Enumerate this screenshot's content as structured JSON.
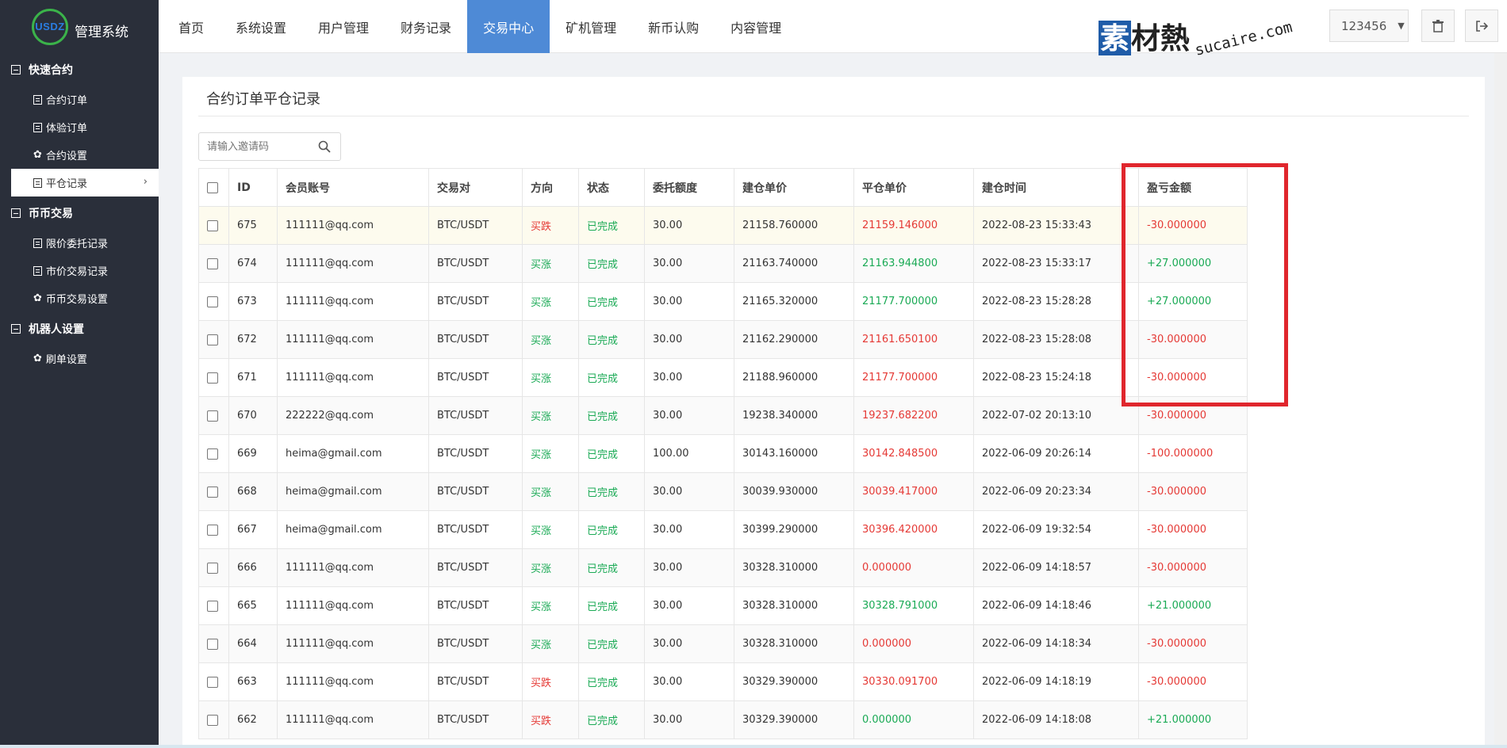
{
  "brand": {
    "logo_text": "USDZ",
    "title": "管理系统"
  },
  "sidebar": {
    "groups": [
      {
        "title": "快速合约",
        "items": [
          {
            "label": "合约订单",
            "icon": "doc-icon"
          },
          {
            "label": "体验订单",
            "icon": "doc-icon"
          },
          {
            "label": "合约设置",
            "icon": "gear-icon"
          },
          {
            "label": "平仓记录",
            "icon": "doc-icon",
            "active": true
          }
        ]
      },
      {
        "title": "币币交易",
        "items": [
          {
            "label": "限价委托记录",
            "icon": "doc-icon"
          },
          {
            "label": "市价交易记录",
            "icon": "doc-icon"
          },
          {
            "label": "币币交易设置",
            "icon": "gear-icon"
          }
        ]
      },
      {
        "title": "机器人设置",
        "items": [
          {
            "label": "刷单设置",
            "icon": "gear-icon"
          }
        ]
      }
    ]
  },
  "topnav": {
    "tabs": [
      "首页",
      "系统设置",
      "用户管理",
      "财务记录",
      "交易中心",
      "矿机管理",
      "新币认购",
      "内容管理"
    ],
    "active": "交易中心"
  },
  "watermark": {
    "main_a": "素",
    "main_b": "材熱",
    "sub": "sucaire.com"
  },
  "user": {
    "name": "123456"
  },
  "panel": {
    "title": "合约订单平仓记录"
  },
  "search": {
    "placeholder": "请输入邀请码"
  },
  "colors": {
    "accent": "#4e8ad6",
    "sidebar": "#2a2f3a",
    "up": "#1aaa55",
    "down": "#e53935",
    "highlight_box": "#e0262d"
  },
  "table": {
    "headers": [
      "ID",
      "会员账号",
      "交易对",
      "方向",
      "状态",
      "委托额度",
      "建仓单价",
      "平仓单价",
      "建仓时间",
      "盈亏金额"
    ],
    "rows": [
      {
        "id": "675",
        "account": "111111@qq.com",
        "pair": "BTC/USDT",
        "dir": "买跌",
        "status": "已完成",
        "amount": "30.00",
        "open": "21158.760000",
        "close": "21159.146000",
        "close_color": "red",
        "time": "2022-08-23 15:33:43",
        "pnl": "-30.000000",
        "pnl_color": "red",
        "dir_color": "red"
      },
      {
        "id": "674",
        "account": "111111@qq.com",
        "pair": "BTC/USDT",
        "dir": "买涨",
        "status": "已完成",
        "amount": "30.00",
        "open": "21163.740000",
        "close": "21163.944800",
        "close_color": "green",
        "time": "2022-08-23 15:33:17",
        "pnl": "+27.000000",
        "pnl_color": "green",
        "dir_color": "green"
      },
      {
        "id": "673",
        "account": "111111@qq.com",
        "pair": "BTC/USDT",
        "dir": "买涨",
        "status": "已完成",
        "amount": "30.00",
        "open": "21165.320000",
        "close": "21177.700000",
        "close_color": "green",
        "time": "2022-08-23 15:28:28",
        "pnl": "+27.000000",
        "pnl_color": "green",
        "dir_color": "green"
      },
      {
        "id": "672",
        "account": "111111@qq.com",
        "pair": "BTC/USDT",
        "dir": "买涨",
        "status": "已完成",
        "amount": "30.00",
        "open": "21162.290000",
        "close": "21161.650100",
        "close_color": "red",
        "time": "2022-08-23 15:28:08",
        "pnl": "-30.000000",
        "pnl_color": "red",
        "dir_color": "green"
      },
      {
        "id": "671",
        "account": "111111@qq.com",
        "pair": "BTC/USDT",
        "dir": "买涨",
        "status": "已完成",
        "amount": "30.00",
        "open": "21188.960000",
        "close": "21177.700000",
        "close_color": "red",
        "time": "2022-08-23 15:24:18",
        "pnl": "-30.000000",
        "pnl_color": "red",
        "dir_color": "green"
      },
      {
        "id": "670",
        "account": "222222@qq.com",
        "pair": "BTC/USDT",
        "dir": "买涨",
        "status": "已完成",
        "amount": "30.00",
        "open": "19238.340000",
        "close": "19237.682200",
        "close_color": "red",
        "time": "2022-07-02 20:13:10",
        "pnl": "-30.000000",
        "pnl_color": "red",
        "dir_color": "green"
      },
      {
        "id": "669",
        "account": "heima@gmail.com",
        "pair": "BTC/USDT",
        "dir": "买涨",
        "status": "已完成",
        "amount": "100.00",
        "open": "30143.160000",
        "close": "30142.848500",
        "close_color": "red",
        "time": "2022-06-09 20:26:14",
        "pnl": "-100.000000",
        "pnl_color": "red",
        "dir_color": "green"
      },
      {
        "id": "668",
        "account": "heima@gmail.com",
        "pair": "BTC/USDT",
        "dir": "买涨",
        "status": "已完成",
        "amount": "30.00",
        "open": "30039.930000",
        "close": "30039.417000",
        "close_color": "red",
        "time": "2022-06-09 20:23:34",
        "pnl": "-30.000000",
        "pnl_color": "red",
        "dir_color": "green"
      },
      {
        "id": "667",
        "account": "heima@gmail.com",
        "pair": "BTC/USDT",
        "dir": "买涨",
        "status": "已完成",
        "amount": "30.00",
        "open": "30399.290000",
        "close": "30396.420000",
        "close_color": "red",
        "time": "2022-06-09 19:32:54",
        "pnl": "-30.000000",
        "pnl_color": "red",
        "dir_color": "green"
      },
      {
        "id": "666",
        "account": "111111@qq.com",
        "pair": "BTC/USDT",
        "dir": "买涨",
        "status": "已完成",
        "amount": "30.00",
        "open": "30328.310000",
        "close": "0.000000",
        "close_color": "red",
        "time": "2022-06-09 14:18:57",
        "pnl": "-30.000000",
        "pnl_color": "red",
        "dir_color": "green"
      },
      {
        "id": "665",
        "account": "111111@qq.com",
        "pair": "BTC/USDT",
        "dir": "买涨",
        "status": "已完成",
        "amount": "30.00",
        "open": "30328.310000",
        "close": "30328.791000",
        "close_color": "green",
        "time": "2022-06-09 14:18:46",
        "pnl": "+21.000000",
        "pnl_color": "green",
        "dir_color": "green"
      },
      {
        "id": "664",
        "account": "111111@qq.com",
        "pair": "BTC/USDT",
        "dir": "买涨",
        "status": "已完成",
        "amount": "30.00",
        "open": "30328.310000",
        "close": "0.000000",
        "close_color": "red",
        "time": "2022-06-09 14:18:34",
        "pnl": "-30.000000",
        "pnl_color": "red",
        "dir_color": "green"
      },
      {
        "id": "663",
        "account": "111111@qq.com",
        "pair": "BTC/USDT",
        "dir": "买跌",
        "status": "已完成",
        "amount": "30.00",
        "open": "30329.390000",
        "close": "30330.091700",
        "close_color": "red",
        "time": "2022-06-09 14:18:19",
        "pnl": "-30.000000",
        "pnl_color": "red",
        "dir_color": "red"
      },
      {
        "id": "662",
        "account": "111111@qq.com",
        "pair": "BTC/USDT",
        "dir": "买跌",
        "status": "已完成",
        "amount": "30.00",
        "open": "30329.390000",
        "close": "0.000000",
        "close_color": "green",
        "time": "2022-06-09 14:18:08",
        "pnl": "+21.000000",
        "pnl_color": "green",
        "dir_color": "red"
      }
    ]
  }
}
